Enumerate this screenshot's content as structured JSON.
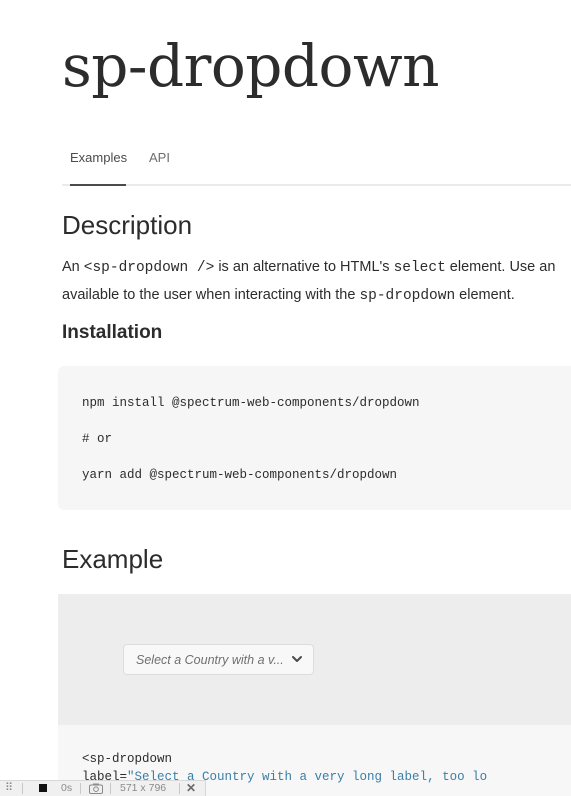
{
  "page": {
    "title": "sp-dropdown"
  },
  "tabs": [
    {
      "label": "Examples"
    },
    {
      "label": "API"
    }
  ],
  "description": {
    "heading": "Description",
    "line1_pre": "An ",
    "line1_code1": "<sp-dropdown />",
    "line1_mid": " is an alternative to HTML's ",
    "line1_code2": "select",
    "line1_post": " element. Use an",
    "line2_pre": "available to the user when interacting with the ",
    "line2_code": "sp-dropdown",
    "line2_post": " element."
  },
  "installation": {
    "heading": "Installation",
    "code_lines": [
      "npm install @spectrum-web-components/dropdown",
      "# or",
      "yarn add @spectrum-web-components/dropdown"
    ]
  },
  "example": {
    "heading": "Example",
    "dropdown_label": "Select a Country with a v...",
    "code_line1": "<sp-dropdown",
    "code_line2_attr": "    label=",
    "code_line2_str": "\"Select a Country with a very long label, too lo"
  },
  "devbar": {
    "time": "0s",
    "size": "571 x 796"
  }
}
